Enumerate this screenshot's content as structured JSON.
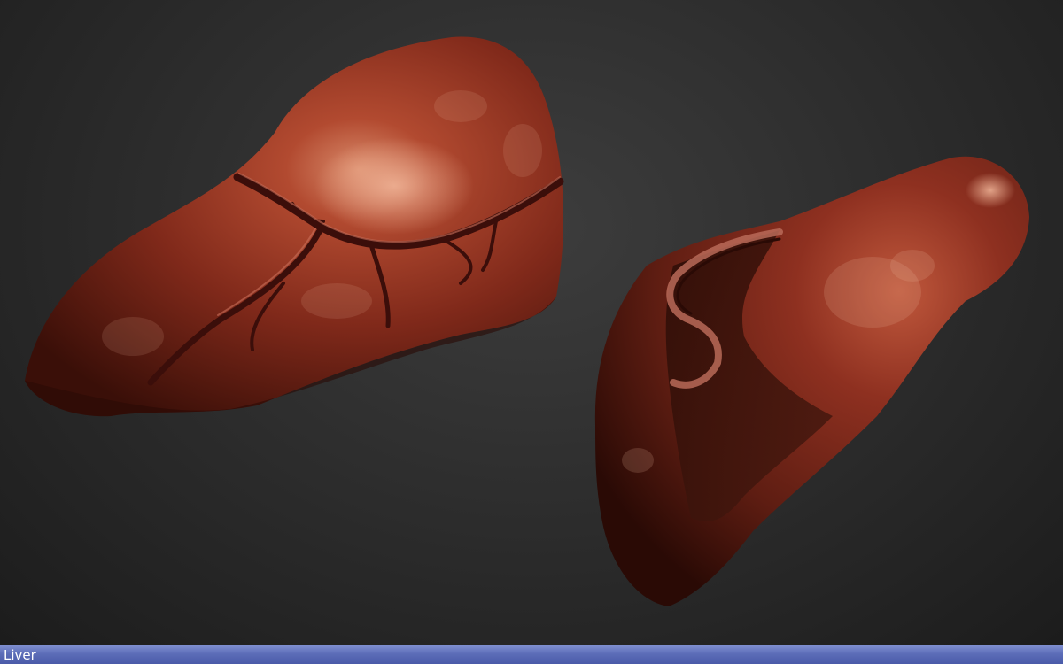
{
  "viewport": {
    "background_color": "#2e2e2e",
    "objects": [
      {
        "name": "liver-model-front",
        "base_color": "#8a2e1c"
      },
      {
        "name": "liver-model-back",
        "base_color": "#7a2818"
      }
    ]
  },
  "status_bar": {
    "label": "Liver",
    "background_color": "#5c6db8",
    "text_color": "#ffffff"
  }
}
